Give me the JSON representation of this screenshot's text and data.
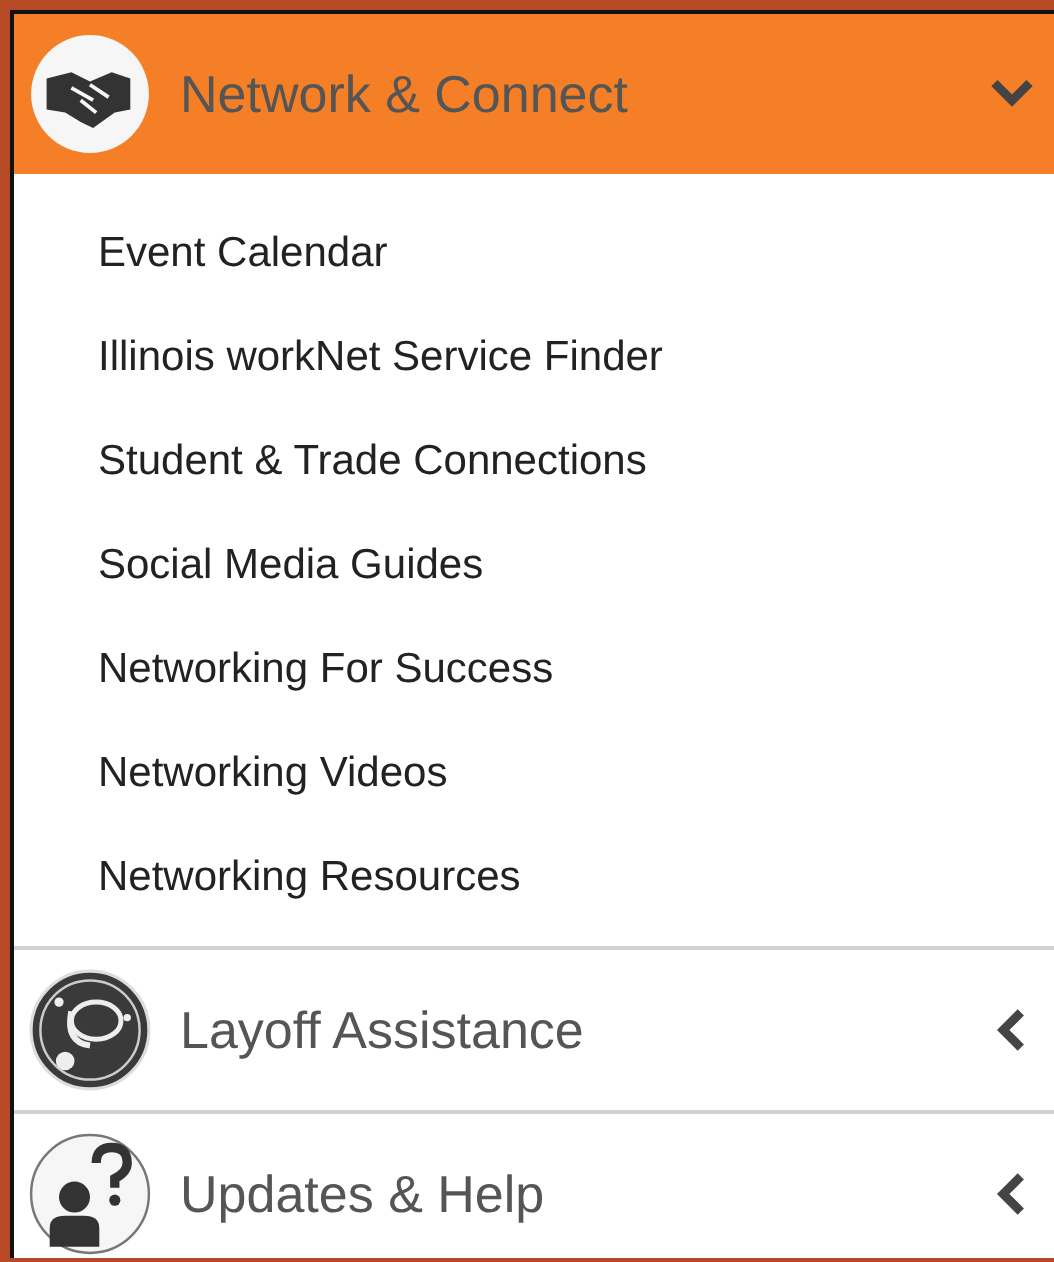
{
  "sections": [
    {
      "title": "Network & Connect",
      "expanded": true,
      "items": [
        "Event Calendar",
        "Illinois workNet Service Finder",
        "Student & Trade Connections",
        "Social Media Guides",
        "Networking For Success",
        "Networking Videos",
        "Networking Resources"
      ]
    },
    {
      "title": "Layoff Assistance",
      "expanded": false
    },
    {
      "title": "Updates & Help",
      "expanded": false
    }
  ]
}
